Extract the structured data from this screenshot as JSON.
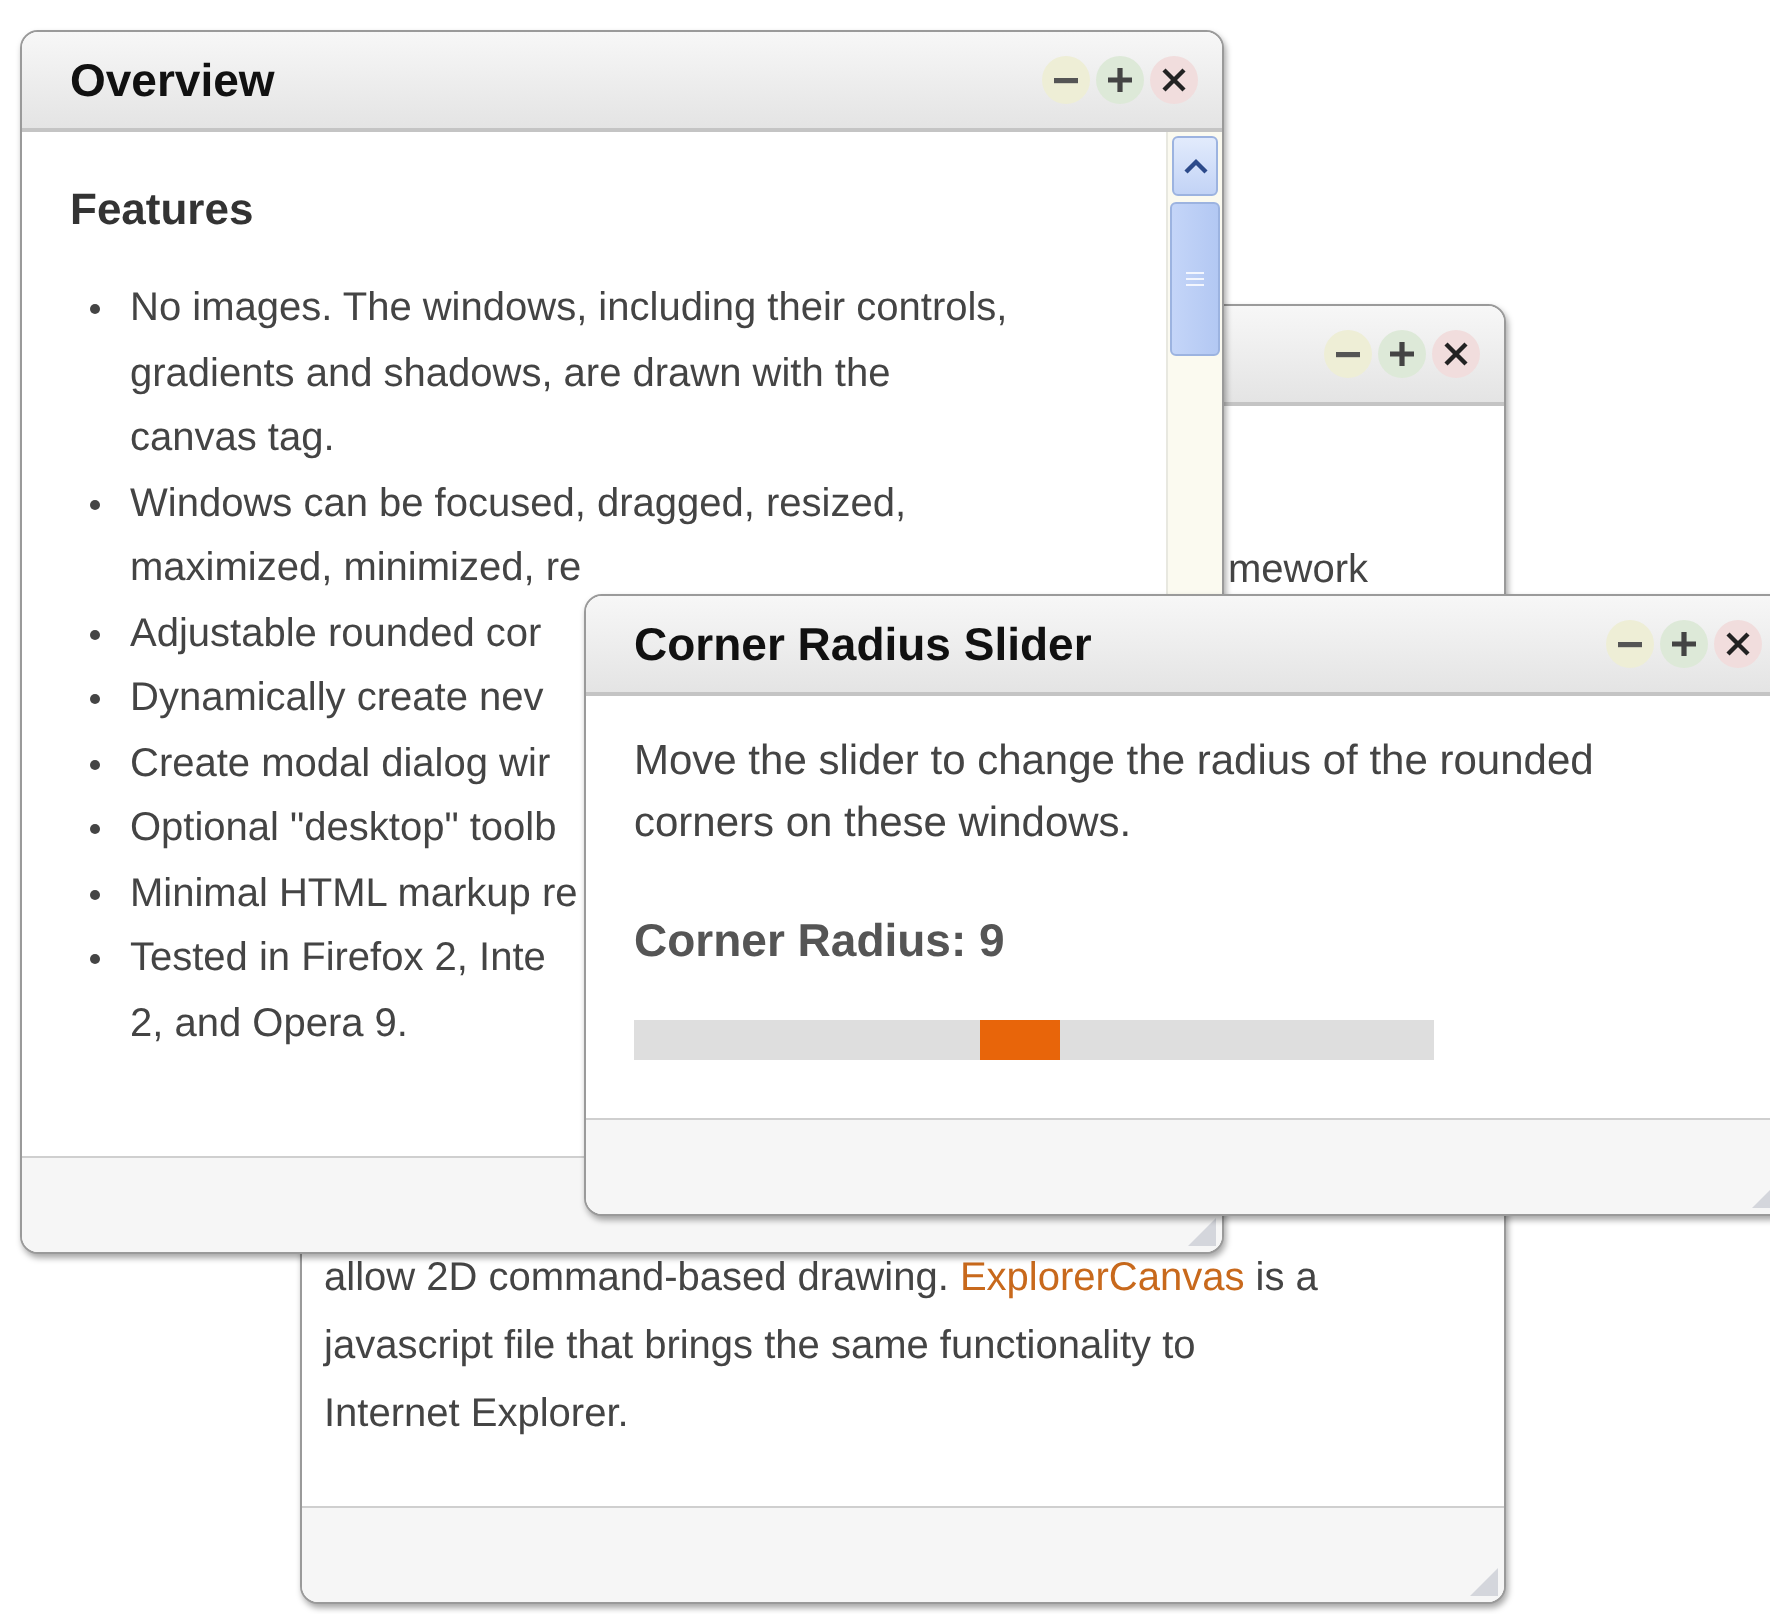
{
  "windows": [
    {
      "kind": "article",
      "fragment": "mework",
      "paragraph": {
        "before": "allow 2D command-based drawing.",
        "link": "ExplorerCanvas",
        "after": "is a",
        "continuation": [
          "javascript file that brings the same functionality to",
          "Internet Explorer."
        ]
      }
    },
    {
      "kind": "list",
      "title": "Overview",
      "heading": "Features",
      "items": [
        {
          "lines": [
            "No images. The windows, including their controls,",
            "gradients and shadows, are drawn with the",
            "canvas tag."
          ]
        },
        {
          "lines": [
            "Windows can be focused, dragged, resized,",
            "maximized, minimized, re"
          ]
        },
        {
          "lines": [
            "Adjustable rounded cor"
          ]
        },
        {
          "lines": [
            "Dynamically create nev"
          ]
        },
        {
          "lines": [
            "Create modal dialog wir"
          ]
        },
        {
          "lines": [
            "Optional \"desktop\" toolb"
          ]
        },
        {
          "lines": [
            "Minimal HTML markup re"
          ]
        },
        {
          "lines": [
            "Tested in Firefox 2, Inte",
            "2, and Opera 9."
          ]
        }
      ]
    },
    {
      "kind": "slider",
      "title": "Corner Radius Slider",
      "description": "Move the slider to change the radius of the rounded corners on these windows.",
      "label": "Corner Radius: 9",
      "level": 0.48
    }
  ]
}
